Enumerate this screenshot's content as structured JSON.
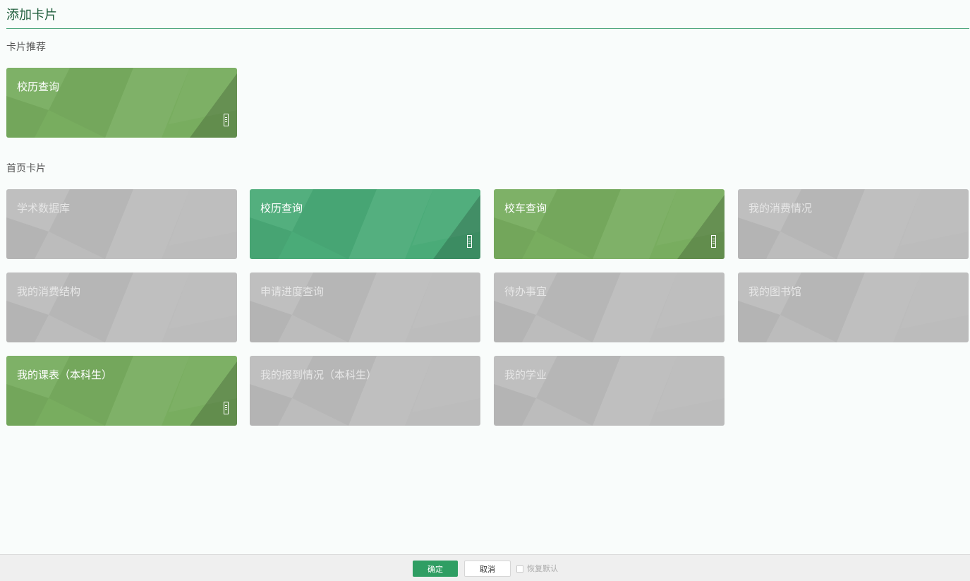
{
  "header": {
    "title": "添加卡片"
  },
  "recommended": {
    "section_title": "卡片推荐",
    "cards": [
      {
        "label": "校历查询",
        "theme": "green"
      }
    ]
  },
  "home": {
    "section_title": "首页卡片",
    "cards": [
      {
        "label": "学术数据库",
        "theme": "gray"
      },
      {
        "label": "校历查询",
        "theme": "teal"
      },
      {
        "label": "校车查询",
        "theme": "green"
      },
      {
        "label": "我的消费情况",
        "theme": "gray"
      },
      {
        "label": "我的消费结构",
        "theme": "gray"
      },
      {
        "label": "申请进度查询",
        "theme": "gray"
      },
      {
        "label": "待办事宜",
        "theme": "gray"
      },
      {
        "label": "我的图书馆",
        "theme": "gray"
      },
      {
        "label": "我的课表（本科生）",
        "theme": "green"
      },
      {
        "label": "我的报到情况（本科生）",
        "theme": "gray"
      },
      {
        "label": "我的学业",
        "theme": "gray"
      }
    ]
  },
  "footer": {
    "ok_label": "确定",
    "cancel_label": "取消",
    "restore_label": "恢复默认"
  },
  "colors": {
    "green": "#78ad5f",
    "teal": "#4aab78",
    "gray": "#bcbcbc",
    "accent": "#2f9e63"
  },
  "icons": {
    "card_corner": "phone-icon"
  }
}
